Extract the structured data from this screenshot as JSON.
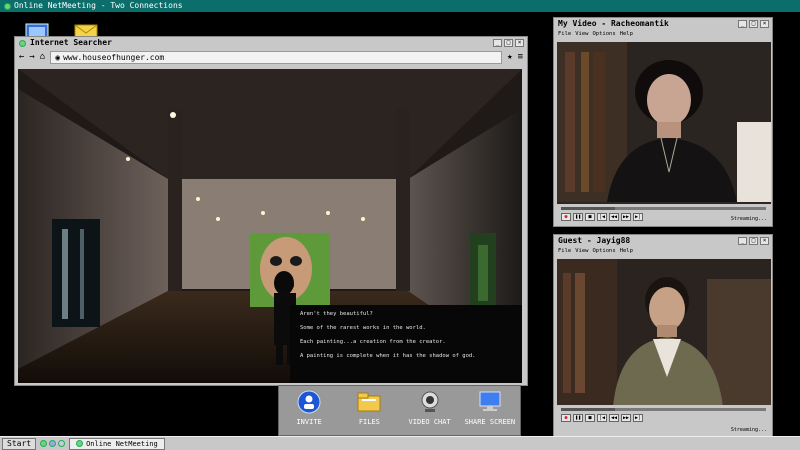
{
  "main_title": "Online NetMeeting - Two Connections",
  "browser": {
    "title": "Internet Searcher",
    "url": "www.houseofhunger.com",
    "caption_lines": [
      "Aren't they beautiful?",
      "Some of the rarest works in the world.",
      "Each painting...a creation from the creator.",
      "A painting is complete when it has the shadow of god."
    ]
  },
  "video1": {
    "title": "My Video - Racheomantik",
    "menus": [
      "File",
      "View",
      "Options",
      "Help"
    ],
    "status": "Streaming..."
  },
  "video2": {
    "title": "Guest - Jayig88",
    "menus": [
      "File",
      "View",
      "Options",
      "Help"
    ],
    "status": "Streaming..."
  },
  "toolbar": {
    "invite": "INVITE",
    "files": "FILES",
    "video_chat": "VIDEO CHAT",
    "share_screen": "SHARE SCREEN"
  },
  "taskbar": {
    "start": "Start",
    "task": "Online NetMeeting"
  },
  "colors": {
    "title_teal": "#0b6e6b",
    "chrome_gray": "#c8c8c8",
    "record_red": "#d22"
  }
}
